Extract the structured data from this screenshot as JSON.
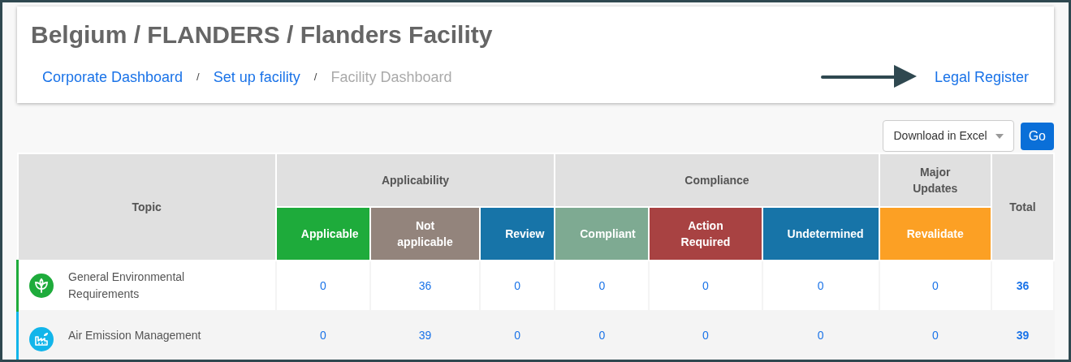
{
  "header": {
    "title": "Belgium / FLANDERS / Flanders Facility",
    "breadcrumbs": [
      {
        "label": "Corporate Dashboard",
        "kind": "link"
      },
      {
        "label": "Set up facility",
        "kind": "link"
      },
      {
        "label": "Facility Dashboard",
        "kind": "current"
      }
    ],
    "separator": "/",
    "legal_register": "Legal Register"
  },
  "export": {
    "value": "Download in Excel",
    "button": "Go"
  },
  "table": {
    "topic_heading": "Topic",
    "total_heading": "Total",
    "groups": [
      {
        "label": "Applicability",
        "columns": [
          {
            "label": "Applicable",
            "color": "#1eab3b"
          },
          {
            "label": "Not applicable",
            "color": "#93847c"
          },
          {
            "label": "Review",
            "color": "#1774a8"
          }
        ]
      },
      {
        "label": "Compliance",
        "columns": [
          {
            "label": "Compliant",
            "color": "#7eaa92"
          },
          {
            "label": "Action Required",
            "color": "#a84242"
          },
          {
            "label": "Undetermined",
            "color": "#1774a8"
          }
        ]
      },
      {
        "label": "Major Updates",
        "columns": [
          {
            "label": "Revalidate",
            "color": "#fca024"
          }
        ]
      }
    ],
    "rows": [
      {
        "topic": "General Environmental Requirements",
        "color": "#1eab3b",
        "values": [
          "0",
          "36",
          "0",
          "0",
          "0",
          "0",
          "0"
        ],
        "total": "36"
      },
      {
        "topic": "Air Emission Management",
        "color": "#12b5ea",
        "values": [
          "0",
          "39",
          "0",
          "0",
          "0",
          "0",
          "0"
        ],
        "total": "39"
      }
    ]
  }
}
